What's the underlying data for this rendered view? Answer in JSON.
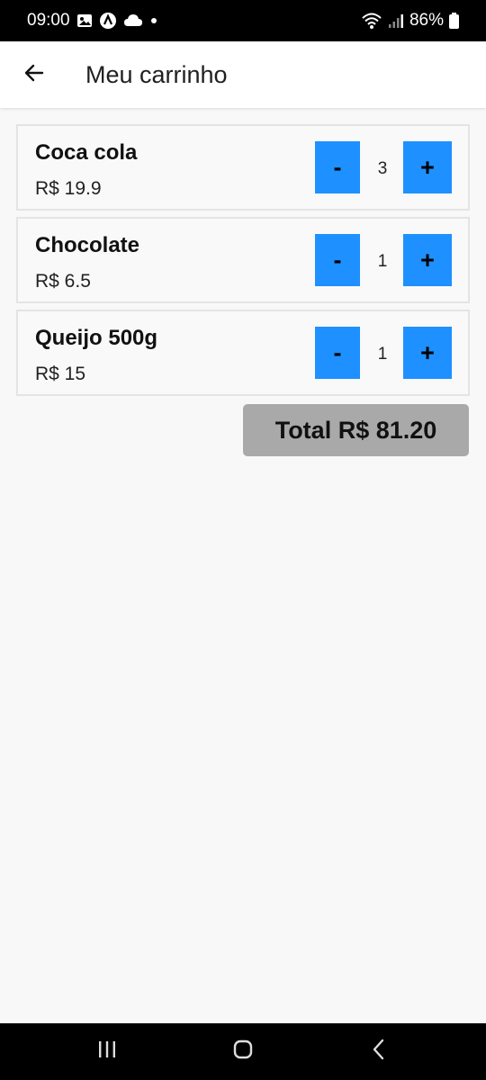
{
  "status_bar": {
    "time": "09:00",
    "battery": "86%",
    "icons": [
      "image-icon",
      "app-icon",
      "cloud-icon",
      "dot-icon",
      "wifi-icon",
      "signal-icon",
      "battery-icon"
    ]
  },
  "app_bar": {
    "title": "Meu carrinho",
    "back_icon": "arrow-left-icon"
  },
  "cart": {
    "items": [
      {
        "name": "Coca cola",
        "price": "R$ 19.9",
        "quantity": "3",
        "minus_label": "-",
        "plus_label": "+"
      },
      {
        "name": "Chocolate",
        "price": "R$ 6.5",
        "quantity": "1",
        "minus_label": "-",
        "plus_label": "+"
      },
      {
        "name": "Queijo 500g",
        "price": "R$ 15",
        "quantity": "1",
        "minus_label": "-",
        "plus_label": "+"
      }
    ],
    "total": "Total R$ 81.20"
  },
  "nav_bar": {
    "buttons": [
      "recents-icon",
      "home-icon",
      "back-icon"
    ]
  },
  "colors": {
    "accent": "#1e90ff",
    "total_bg": "#a9a9a9",
    "background": "#f8f8f8"
  }
}
